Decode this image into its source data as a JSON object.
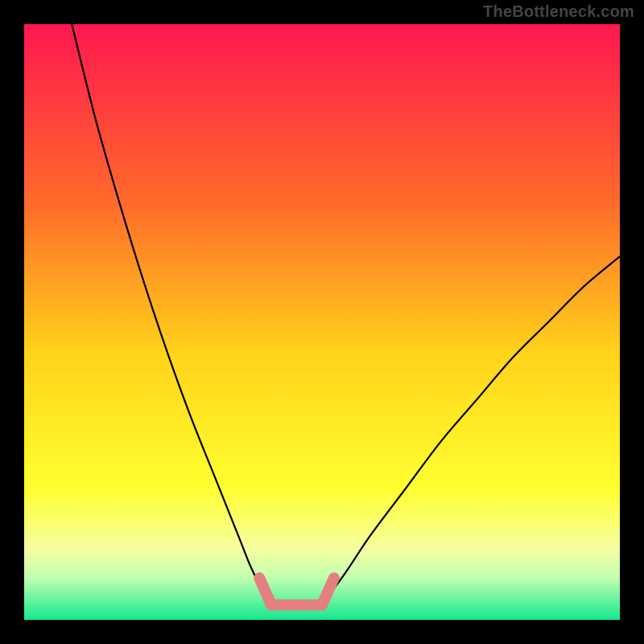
{
  "watermark": "TheBottleneck.com",
  "chart_data": {
    "type": "line",
    "title": "",
    "xlabel": "",
    "ylabel": "",
    "xlim": [
      0,
      100
    ],
    "ylim": [
      0,
      100
    ],
    "grid": false,
    "legend": false,
    "background_gradient": {
      "type": "vertical",
      "stops": [
        {
          "offset": 0.0,
          "color": "#ff1850"
        },
        {
          "offset": 0.3,
          "color": "#ff6a2a"
        },
        {
          "offset": 0.55,
          "color": "#ffd21a"
        },
        {
          "offset": 0.78,
          "color": "#ffff30"
        },
        {
          "offset": 0.88,
          "color": "#f6ffa0"
        },
        {
          "offset": 0.93,
          "color": "#c0ffb0"
        },
        {
          "offset": 1.0,
          "color": "#15e890"
        }
      ]
    },
    "series": [
      {
        "name": "left-branch",
        "color": "#000000",
        "x": [
          8,
          12,
          16,
          20,
          24,
          28,
          32,
          36,
          38,
          40,
          41.5
        ],
        "y": [
          100,
          84,
          70,
          57,
          45,
          34,
          24,
          14,
          9,
          5,
          2.5
        ]
      },
      {
        "name": "right-branch",
        "color": "#000000",
        "x": [
          50,
          54,
          58,
          64,
          70,
          76,
          82,
          88,
          94,
          100
        ],
        "y": [
          2.5,
          8,
          14,
          22,
          30,
          37,
          44,
          50,
          56,
          61
        ]
      },
      {
        "name": "highlight-left",
        "color": "#e58080",
        "thick": true,
        "x": [
          39.5,
          41.5
        ],
        "y": [
          7,
          2.5
        ]
      },
      {
        "name": "highlight-bottom",
        "color": "#e58080",
        "thick": true,
        "x": [
          41.5,
          50
        ],
        "y": [
          2.5,
          2.5
        ]
      },
      {
        "name": "highlight-right",
        "color": "#e58080",
        "thick": true,
        "x": [
          50,
          52
        ],
        "y": [
          2.5,
          7
        ]
      }
    ]
  }
}
